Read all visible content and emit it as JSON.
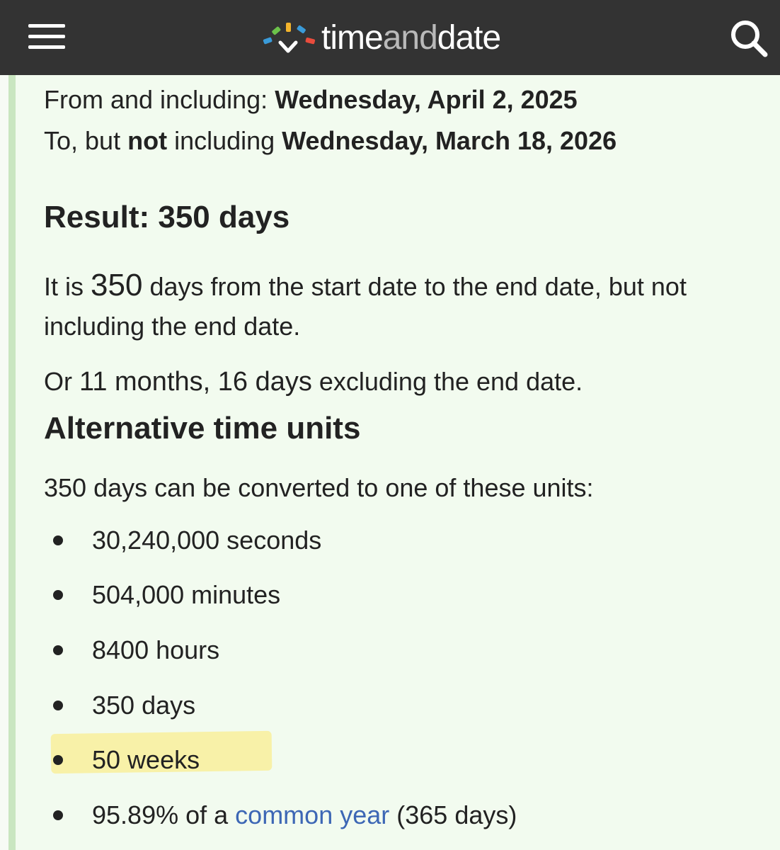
{
  "header": {
    "logo_time": "time",
    "logo_and": "and",
    "logo_date": "date",
    "menu_icon": "hamburger-menu-icon",
    "search_icon": "search-icon",
    "logo_colors": [
      "#e94c3d",
      "#f3b42c",
      "#3a9bd9",
      "#6cc24a",
      "#9b59b6"
    ]
  },
  "range": {
    "from_label": "From and including:",
    "from_date": "Wednesday, April 2, 2025",
    "to_label_1": "To, but",
    "to_label_not": "not",
    "to_label_2": "including",
    "to_date": "Wednesday, March 18, 2026"
  },
  "result": {
    "title": "Result: 350 days",
    "p1_a": "It is",
    "p1_num": "350",
    "p1_b": "days from the start date to the end date, but not",
    "p1_c": "including the end date.",
    "p2_a": "Or",
    "p2_months": "11 months, 16 days",
    "p2_b": "excluding the end date."
  },
  "alt": {
    "title": "Alternative time units",
    "intro": "350 days can be converted to one of these units:",
    "items": [
      "30,240,000 seconds",
      "504,000 minutes",
      "8400 hours",
      "350 days",
      "50 weeks"
    ],
    "last_pre": "95.89% of a",
    "last_link": "common year",
    "last_post": "(365 days)",
    "highlight_color": "#f8efa0"
  }
}
